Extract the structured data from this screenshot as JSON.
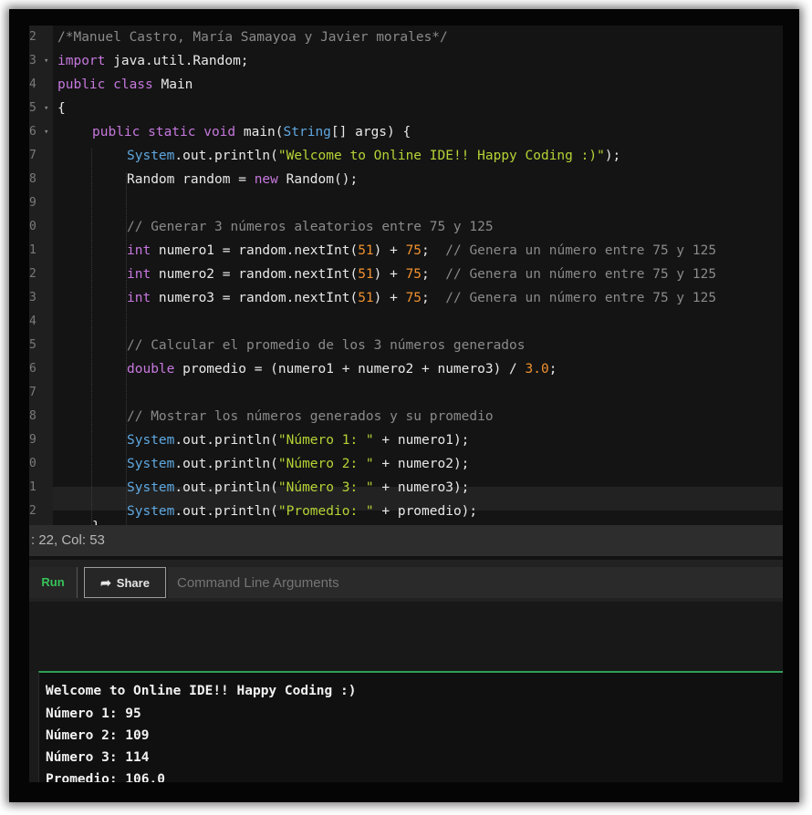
{
  "editor": {
    "line_numbers": [
      "2",
      "3",
      "4",
      "5",
      "6",
      "7",
      "8",
      "9",
      "0",
      "1",
      "2",
      "3",
      "4",
      "5",
      "6",
      "7",
      "8",
      "9",
      "0",
      "1",
      "2",
      "3"
    ],
    "active_line": "2",
    "code": {
      "l2": {
        "c1": "/*Manuel Castro, María Samayoa y Javier morales*/"
      },
      "l3": {
        "kw": "import",
        "rest": " java.util.Random;"
      },
      "l4": {
        "kw": "public class",
        "rest": " Main"
      },
      "l5": {
        "brace": "{"
      },
      "l6": {
        "kw": "public static void",
        "name": " main(",
        "ty": "String",
        "rest": "[] args) {"
      },
      "l7": {
        "ty": "System",
        "rest1": ".out.println(",
        "str": "\"Welcome to Online IDE!! Happy Coding :)\"",
        "rest2": ");"
      },
      "l8": {
        "rest1": "Random random = ",
        "kw": "new",
        "rest2": " Random();"
      },
      "l10": {
        "cm": "// Generar 3 números aleatorios entre 75 y 125"
      },
      "l11": {
        "kw": "int",
        "rest1": " numero1 = random.nextInt(",
        "n1": "51",
        "rest2": ") + ",
        "n2": "75",
        "rest3": ";  ",
        "cm": "// Genera un número entre 75 y 125"
      },
      "l12": {
        "kw": "int",
        "rest1": " numero2 = random.nextInt(",
        "n1": "51",
        "rest2": ") + ",
        "n2": "75",
        "rest3": ";  ",
        "cm": "// Genera un número entre 75 y 125"
      },
      "l13": {
        "kw": "int",
        "rest1": " numero3 = random.nextInt(",
        "n1": "51",
        "rest2": ") + ",
        "n2": "75",
        "rest3": ";  ",
        "cm": "// Genera un número entre 75 y 125"
      },
      "l15": {
        "cm": "// Calcular el promedio de los 3 números generados"
      },
      "l16": {
        "kw": "double",
        "rest1": " promedio = (numero1 + numero2 + numero3) / ",
        "n1": "3.0",
        "rest2": ";"
      },
      "l18": {
        "cm": "// Mostrar los números generados y su promedio"
      },
      "l19": {
        "ty": "System",
        "rest1": ".out.println(",
        "str": "\"Número 1: \"",
        "rest2": " + numero1);"
      },
      "l20": {
        "ty": "System",
        "rest1": ".out.println(",
        "str": "\"Número 2: \"",
        "rest2": " + numero2);"
      },
      "l21": {
        "ty": "System",
        "rest1": ".out.println(",
        "str": "\"Número 3: \"",
        "rest2": " + numero3);"
      },
      "l22": {
        "ty": "System",
        "rest1": ".out.println(",
        "str": "\"Promedio: \"",
        "rest2": " + promedio);"
      },
      "l23": {
        "brace": "}"
      }
    }
  },
  "status_bar": {
    "text": ": 22,  Col: 53"
  },
  "toolbar": {
    "run_label": "Run",
    "share_label": "Share",
    "share_icon": "share-arrow-icon",
    "args_placeholder": "Command Line Arguments",
    "args_value": ""
  },
  "output": {
    "lines": [
      "Welcome to Online IDE!! Happy Coding :)",
      "Número 1: 95",
      "Número 2: 109",
      "Número 3: 114",
      "Promedio: 106.0"
    ]
  },
  "colors": {
    "keyword": "#c678dd",
    "type": "#5fa8e0",
    "string": "#b5d336",
    "number": "#f0912e",
    "comment": "#8a8a8a",
    "run_green": "#37c25a"
  }
}
